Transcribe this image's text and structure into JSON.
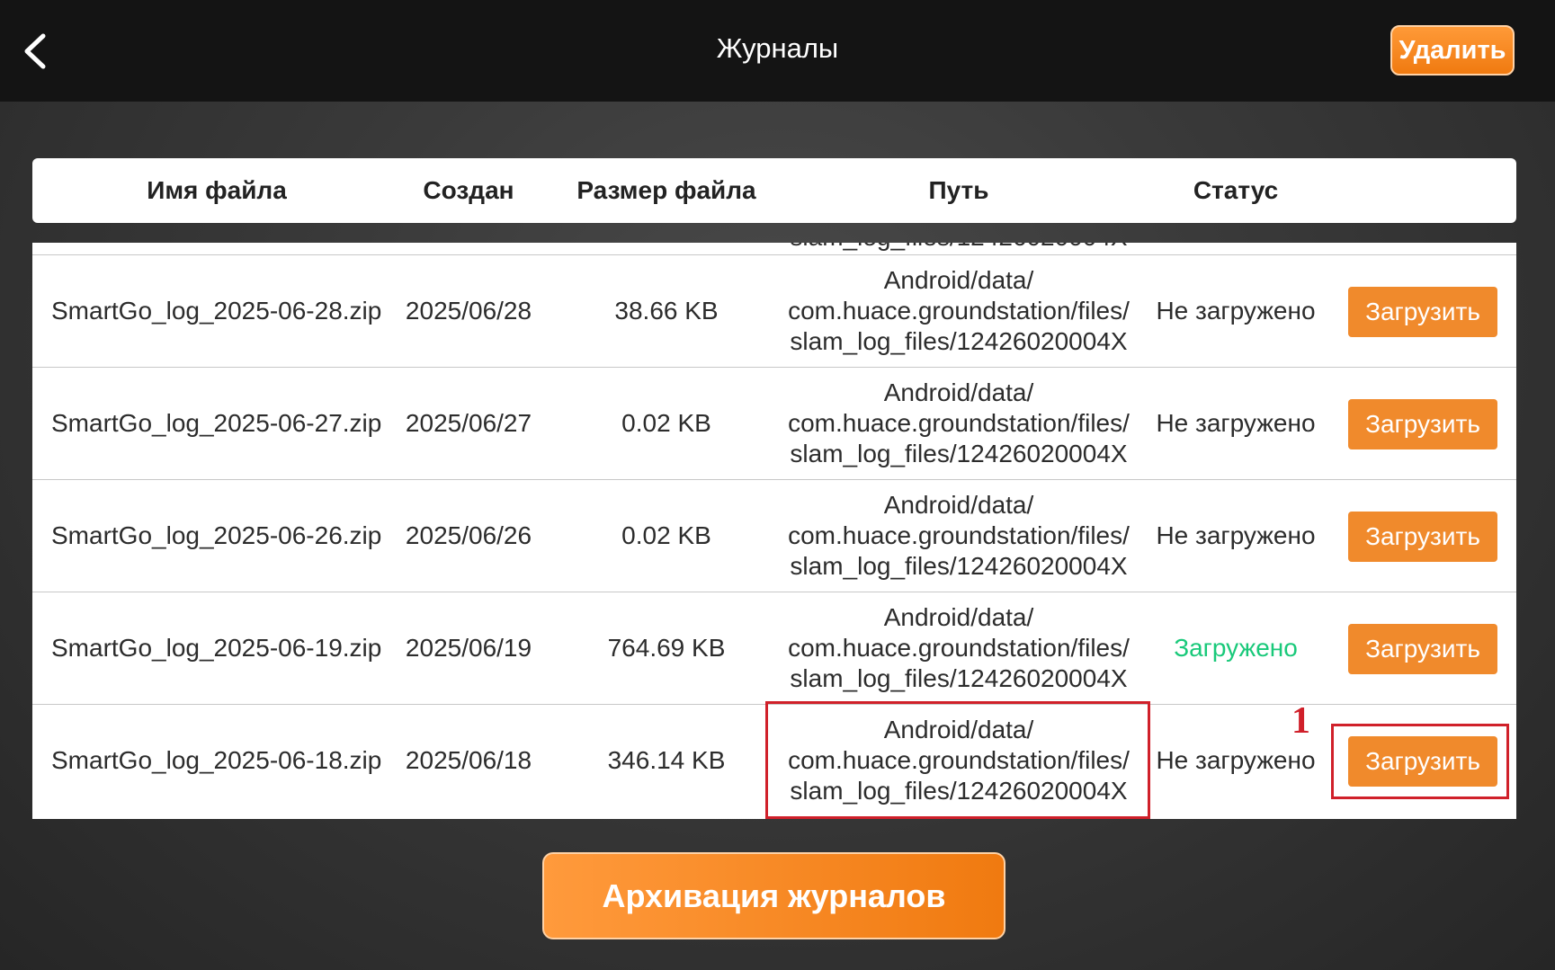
{
  "header": {
    "title": "Журналы",
    "delete_label": "Удалить",
    "back_icon": "chevron-left-icon"
  },
  "columns": {
    "name": "Имя файла",
    "created": "Создан",
    "size": "Размер файла",
    "path": "Путь",
    "status": "Статус"
  },
  "rows": [
    {
      "name": "SmartGo_log_2025-06-28.zip",
      "created": "2025/06/28",
      "size": "38.66 KB",
      "path": [
        "Android/data/",
        "com.huace.groundstation/files/",
        "slam_log_files/12426020004X"
      ],
      "status": "Не загружено",
      "action": "Загрузить"
    },
    {
      "name": "SmartGo_log_2025-06-27.zip",
      "created": "2025/06/27",
      "size": "0.02 KB",
      "path": [
        "Android/data/",
        "com.huace.groundstation/files/",
        "slam_log_files/12426020004X"
      ],
      "status": "Не загружено",
      "action": "Загрузить"
    },
    {
      "name": "SmartGo_log_2025-06-26.zip",
      "created": "2025/06/26",
      "size": "0.02 KB",
      "path": [
        "Android/data/",
        "com.huace.groundstation/files/",
        "slam_log_files/12426020004X"
      ],
      "status": "Не загружено",
      "action": "Загрузить"
    },
    {
      "name": "SmartGo_log_2025-06-19.zip",
      "created": "2025/06/19",
      "size": "764.69 KB",
      "path": [
        "Android/data/",
        "com.huace.groundstation/files/",
        "slam_log_files/12426020004X"
      ],
      "status": "Загружено",
      "action": "Загрузить"
    },
    {
      "name": "SmartGo_log_2025-06-18.zip",
      "created": "2025/06/18",
      "size": "346.14 KB",
      "path": [
        "Android/data/",
        "com.huace.groundstation/files/",
        "slam_log_files/12426020004X"
      ],
      "status": "Не загружено",
      "action": "Загрузить"
    }
  ],
  "annotation": {
    "marker": "1"
  },
  "footer": {
    "archive_label": "Архивация журналов"
  },
  "colors": {
    "accent": "#f08a2c",
    "status_done": "#19c97a",
    "highlight": "#d0202a",
    "topbar": "#141414"
  }
}
